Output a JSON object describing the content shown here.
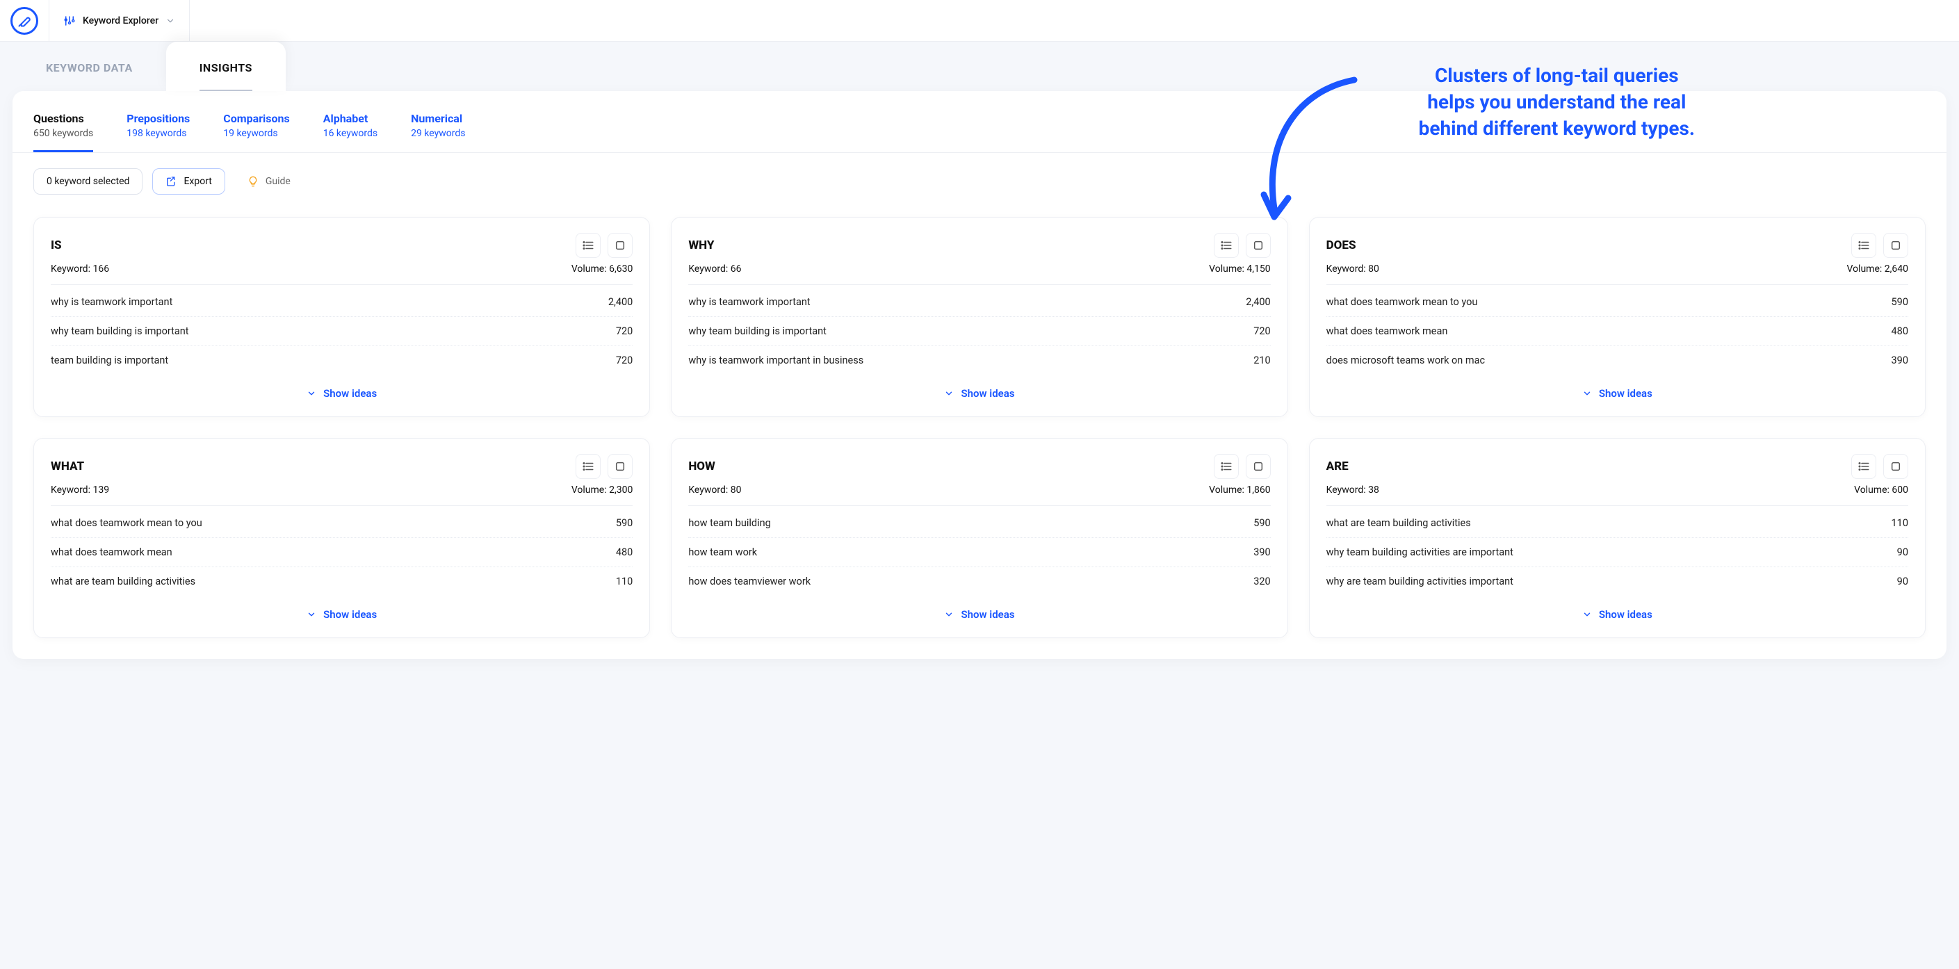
{
  "header": {
    "tool_name": "Keyword Explorer"
  },
  "annotation": {
    "line1": "Clusters of long-tail queries",
    "line2": "helps you understand the real",
    "line3": "behind different keyword types."
  },
  "top_tabs": [
    {
      "label": "KEYWORD DATA",
      "active": false
    },
    {
      "label": "INSIGHTS",
      "active": true
    }
  ],
  "category_tabs": [
    {
      "name": "Questions",
      "count": "650 keywords",
      "active": true
    },
    {
      "name": "Prepositions",
      "count": "198 keywords",
      "active": false
    },
    {
      "name": "Comparisons",
      "count": "19 keywords",
      "active": false
    },
    {
      "name": "Alphabet",
      "count": "16 keywords",
      "active": false
    },
    {
      "name": "Numerical",
      "count": "29 keywords",
      "active": false
    }
  ],
  "toolbar": {
    "selected_label": "0 keyword selected",
    "export_label": "Export",
    "guide_label": "Guide"
  },
  "labels": {
    "keyword_prefix": "Keyword: ",
    "volume_prefix": "Volume: ",
    "show_ideas": "Show ideas"
  },
  "cards": [
    {
      "title": "IS",
      "keyword_count": "166",
      "volume": "6,630",
      "rows": [
        {
          "q": "why is teamwork important",
          "v": "2,400"
        },
        {
          "q": "why team building is important",
          "v": "720"
        },
        {
          "q": "team building is important",
          "v": "720"
        }
      ]
    },
    {
      "title": "WHY",
      "keyword_count": "66",
      "volume": "4,150",
      "rows": [
        {
          "q": "why is teamwork important",
          "v": "2,400"
        },
        {
          "q": "why team building is important",
          "v": "720"
        },
        {
          "q": "why is teamwork important in business",
          "v": "210"
        }
      ]
    },
    {
      "title": "DOES",
      "keyword_count": "80",
      "volume": "2,640",
      "rows": [
        {
          "q": "what does teamwork mean to you",
          "v": "590"
        },
        {
          "q": "what does teamwork mean",
          "v": "480"
        },
        {
          "q": "does microsoft teams work on mac",
          "v": "390"
        }
      ]
    },
    {
      "title": "WHAT",
      "keyword_count": "139",
      "volume": "2,300",
      "rows": [
        {
          "q": "what does teamwork mean to you",
          "v": "590"
        },
        {
          "q": "what does teamwork mean",
          "v": "480"
        },
        {
          "q": "what are team building activities",
          "v": "110"
        }
      ]
    },
    {
      "title": "HOW",
      "keyword_count": "80",
      "volume": "1,860",
      "rows": [
        {
          "q": "how team building",
          "v": "590"
        },
        {
          "q": "how team work",
          "v": "390"
        },
        {
          "q": "how does teamviewer work",
          "v": "320"
        }
      ]
    },
    {
      "title": "ARE",
      "keyword_count": "38",
      "volume": "600",
      "rows": [
        {
          "q": "what are team building activities",
          "v": "110"
        },
        {
          "q": "why team building activities are important",
          "v": "90"
        },
        {
          "q": "why are team building activities important",
          "v": "90"
        }
      ]
    }
  ]
}
